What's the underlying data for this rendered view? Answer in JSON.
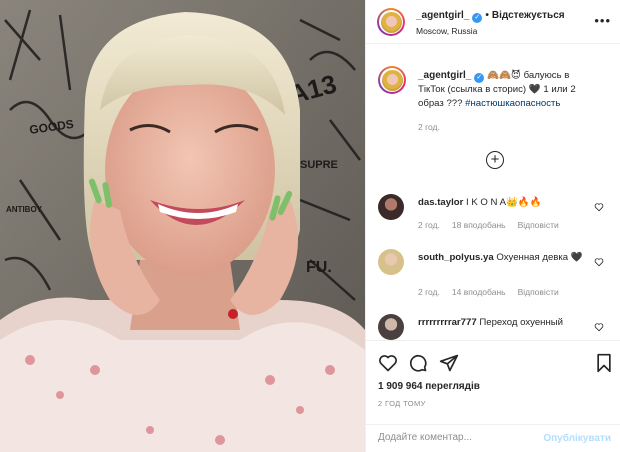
{
  "post": {
    "media_alt": "Video still: smiling woman with platinum blonde bob and long decorated nails, graffiti wall behind her",
    "graffiti": [
      "A13",
      "SUPRE",
      "FU.",
      "ANTIBOY",
      "GOODS"
    ]
  },
  "header": {
    "username": "_agentgirl_",
    "verified_icon": "verified-badge-icon",
    "separator": "•",
    "follow_label": "Відстежується",
    "location": "Moscow, Russia",
    "more_icon": "more-options-icon"
  },
  "caption": {
    "username": "_agentgirl_",
    "emoji_prefix": "🙈🙈😈",
    "text": " балуюсь в ТікТок (ссылка в сторис) 🖤 1 или 2 образ ??? ",
    "hashtag": "#настюшкаопасность",
    "time": "2 год."
  },
  "load_more_icon": "plus-circle-icon",
  "comments": [
    {
      "username": "das.taylor",
      "text": "I K O N A👑🔥🔥",
      "time": "2 год.",
      "likes": "18 вподобань",
      "reply": "Відповісти"
    },
    {
      "username": "south_polyus.ya",
      "text": "Охуенная девка 🖤",
      "time": "2 год.",
      "likes": "14 вподобань",
      "reply": "Відповісти"
    },
    {
      "username": "rrrrrrrrrar777",
      "text": "Переход охуенный",
      "time": "",
      "likes": "",
      "reply": ""
    }
  ],
  "actions": {
    "like_icon": "heart-icon",
    "comment_icon": "comment-icon",
    "share_icon": "share-icon",
    "save_icon": "bookmark-icon",
    "views": "1 909 964 переглядів",
    "date": "2 ГОД ТОМУ"
  },
  "add_comment": {
    "placeholder": "Додайте коментар...",
    "publish_label": "Опублікувати"
  },
  "colors": {
    "link": "#00376b",
    "muted": "#8e8e8e",
    "verified": "#3897f0",
    "publish_disabled": "#b2dffc",
    "border": "#efefef"
  }
}
